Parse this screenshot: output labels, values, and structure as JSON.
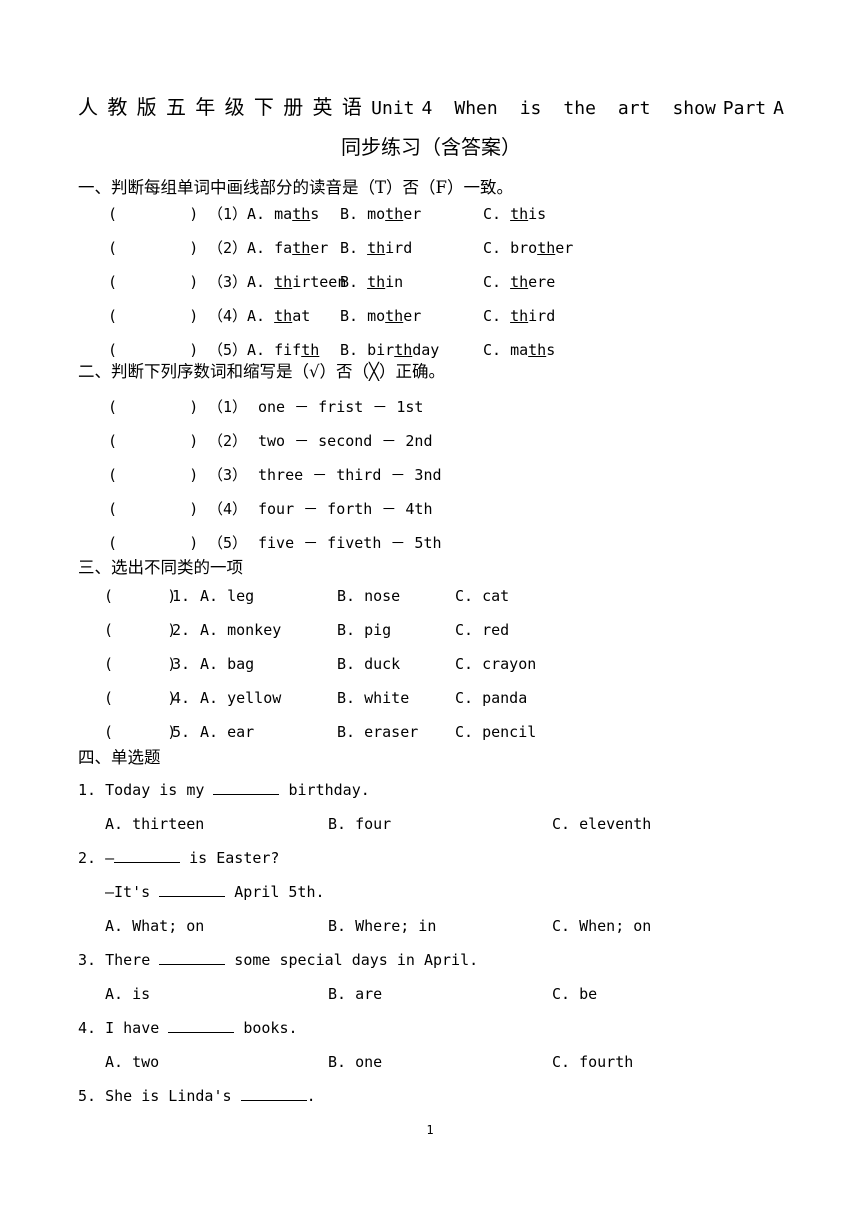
{
  "document": {
    "title_line1_cn": "人教版五年级下册英语",
    "title_line1_en_parts": [
      "Unit",
      "4",
      "When",
      "is",
      "the",
      "art",
      "show",
      "Part",
      "A"
    ],
    "title_line1_full": "人教版五年级下册英语Unit 4  When  is  the  art  show Part A",
    "title_line2": "同步练习（含答案）",
    "page_number": "1"
  },
  "sections": [
    {
      "id": "section-1",
      "heading": "一、判断每组单词中画线部分的读音是（T）否（F）一致。",
      "paren": "(        )",
      "items": [
        {
          "num": "（1）",
          "options": [
            {
              "letter": "A.",
              "pre": "ma",
              "mid": "th",
              "post": "s"
            },
            {
              "letter": "B.",
              "pre": "mo",
              "mid": "th",
              "post": "er"
            },
            {
              "letter": "C.",
              "pre": "",
              "mid": "th",
              "post": "is"
            }
          ]
        },
        {
          "num": "（2）",
          "options": [
            {
              "letter": "A.",
              "pre": "fa",
              "mid": "th",
              "post": "er"
            },
            {
              "letter": "B.",
              "pre": "",
              "mid": "th",
              "post": "ird"
            },
            {
              "letter": "C.",
              "pre": "bro",
              "mid": "th",
              "post": "er"
            }
          ]
        },
        {
          "num": "（3）",
          "options": [
            {
              "letter": "A.",
              "pre": "",
              "mid": "th",
              "post": "irteen"
            },
            {
              "letter": "B.",
              "pre": "",
              "mid": "th",
              "post": "in"
            },
            {
              "letter": "C.",
              "pre": "",
              "mid": "th",
              "post": "ere"
            }
          ]
        },
        {
          "num": "（4）",
          "options": [
            {
              "letter": "A.",
              "pre": "",
              "mid": "th",
              "post": "at"
            },
            {
              "letter": "B.",
              "pre": "mo",
              "mid": "th",
              "post": "er"
            },
            {
              "letter": "C.",
              "pre": "",
              "mid": "th",
              "post": "ird"
            }
          ]
        },
        {
          "num": "（5）",
          "options": [
            {
              "letter": "A.",
              "pre": "fif",
              "mid": "th",
              "post": ""
            },
            {
              "letter": "B.",
              "pre": "bir",
              "mid": "th",
              "post": "day"
            },
            {
              "letter": "C.",
              "pre": "ma",
              "mid": "th",
              "post": "s"
            }
          ]
        }
      ]
    },
    {
      "id": "section-2",
      "heading": "二、判断下列序数词和缩写是（√）否（╳）正确。",
      "paren": "(        )",
      "items": [
        {
          "num": "（1）",
          "text": "one － frist － 1st"
        },
        {
          "num": "（2）",
          "text": "two － second － 2nd"
        },
        {
          "num": "（3）",
          "text": "three － third － 3nd"
        },
        {
          "num": "（4）",
          "text": "four － forth － 4th"
        },
        {
          "num": "（5）",
          "text": "five － fiveth － 5th"
        }
      ]
    },
    {
      "id": "section-3",
      "heading": "三、选出不同类的一项",
      "paren": "(      )",
      "items": [
        {
          "num": "1.",
          "a": "A. leg",
          "b": "B. nose",
          "c": "C. cat"
        },
        {
          "num": "2.",
          "a": "A. monkey",
          "b": "B. pig",
          "c": "C. red"
        },
        {
          "num": "3.",
          "a": "A. bag",
          "b": "B. duck",
          "c": "C. crayon"
        },
        {
          "num": "4.",
          "a": "A. yellow",
          "b": "B. white",
          "c": "C. panda"
        },
        {
          "num": "5.",
          "a": "A. ear",
          "b": "B. eraser",
          "c": "C. pencil"
        }
      ]
    },
    {
      "id": "section-4",
      "heading": "四、单选题",
      "questions": [
        {
          "stem_pre": "1. Today is my ",
          "stem_post": " birthday.",
          "second_line": null,
          "a": "A. thirteen",
          "b": "B. four",
          "c": "C. eleventh"
        },
        {
          "stem_pre": "2. —",
          "stem_post": " is Easter?",
          "second_line_pre": "—It's ",
          "second_line_post": " April 5th.",
          "a": "A. What; on",
          "b": "B. Where; in",
          "c": "C. When; on"
        },
        {
          "stem_pre": "3. There ",
          "stem_post": " some special days in April.",
          "second_line": null,
          "a": "A. is",
          "b": "B. are",
          "c": "C. be"
        },
        {
          "stem_pre": "4. I have ",
          "stem_post": " books.",
          "second_line": null,
          "a": "A. two",
          "b": "B. one",
          "c": "C. fourth"
        },
        {
          "stem_pre": "5. She is Linda's ",
          "stem_post": ".",
          "second_line": null,
          "a": null,
          "b": null,
          "c": null
        }
      ]
    }
  ]
}
